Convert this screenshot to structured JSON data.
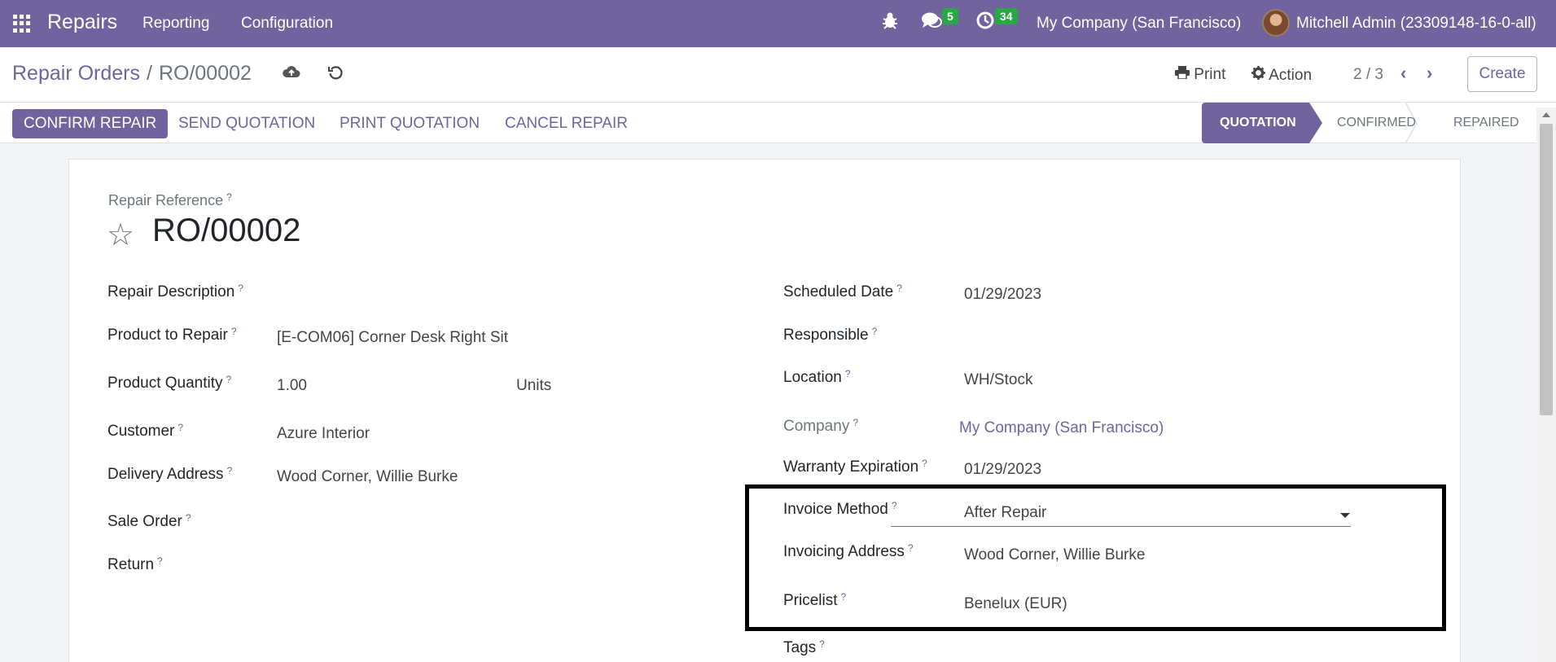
{
  "navbar": {
    "app_name": "Repairs",
    "menu": [
      "Reporting",
      "Configuration"
    ],
    "messages_count": "5",
    "activities_count": "34",
    "company": "My Company (San Francisco)",
    "user": "Mitchell Admin (23309148-16-0-all)",
    "icons": {
      "apps": "apps-grid-icon",
      "debug": "bug-icon",
      "messages": "chat-icon",
      "activities": "clock-icon"
    }
  },
  "control": {
    "breadcrumb_parent": "Repair Orders",
    "breadcrumb_separator": "/",
    "breadcrumb_current": "RO/00002",
    "print_label": "Print",
    "action_label": "Action",
    "pager": "2 / 3",
    "create_label": "Create"
  },
  "statusbar": {
    "buttons": [
      "CONFIRM REPAIR",
      "SEND QUOTATION",
      "PRINT QUOTATION",
      "CANCEL REPAIR"
    ],
    "stages": [
      "QUOTATION",
      "CONFIRMED",
      "REPAIRED"
    ],
    "active_stage": "QUOTATION"
  },
  "form": {
    "ref_label": "Repair Reference",
    "ref_value": "RO/00002",
    "left": {
      "repair_description": {
        "label": "Repair Description",
        "value": ""
      },
      "product": {
        "label": "Product to Repair",
        "value": "[E-COM06] Corner Desk Right Sit"
      },
      "quantity": {
        "label": "Product Quantity",
        "value": "1.00",
        "uom": "Units"
      },
      "customer": {
        "label": "Customer",
        "value": "Azure Interior"
      },
      "delivery_address": {
        "label": "Delivery Address",
        "value": "Wood Corner, Willie Burke"
      },
      "sale_order": {
        "label": "Sale Order",
        "value": ""
      },
      "return": {
        "label": "Return",
        "value": ""
      }
    },
    "right": {
      "scheduled_date": {
        "label": "Scheduled Date",
        "value": "01/29/2023"
      },
      "responsible": {
        "label": "Responsible",
        "value": ""
      },
      "location": {
        "label": "Location",
        "value": "WH/Stock"
      },
      "company": {
        "label": "Company",
        "value": "My Company (San Francisco)"
      },
      "warranty": {
        "label": "Warranty Expiration",
        "value": "01/29/2023"
      },
      "invoice_method": {
        "label": "Invoice Method",
        "value": "After Repair"
      },
      "invoicing_address": {
        "label": "Invoicing Address",
        "value": "Wood Corner, Willie Burke"
      },
      "pricelist": {
        "label": "Pricelist",
        "value": "Benelux (EUR)"
      },
      "tags": {
        "label": "Tags",
        "value": ""
      }
    },
    "help_mark": "?"
  },
  "colors": {
    "brand": "#71639e",
    "badge": "#28a745",
    "highlight_border": "#000000"
  }
}
